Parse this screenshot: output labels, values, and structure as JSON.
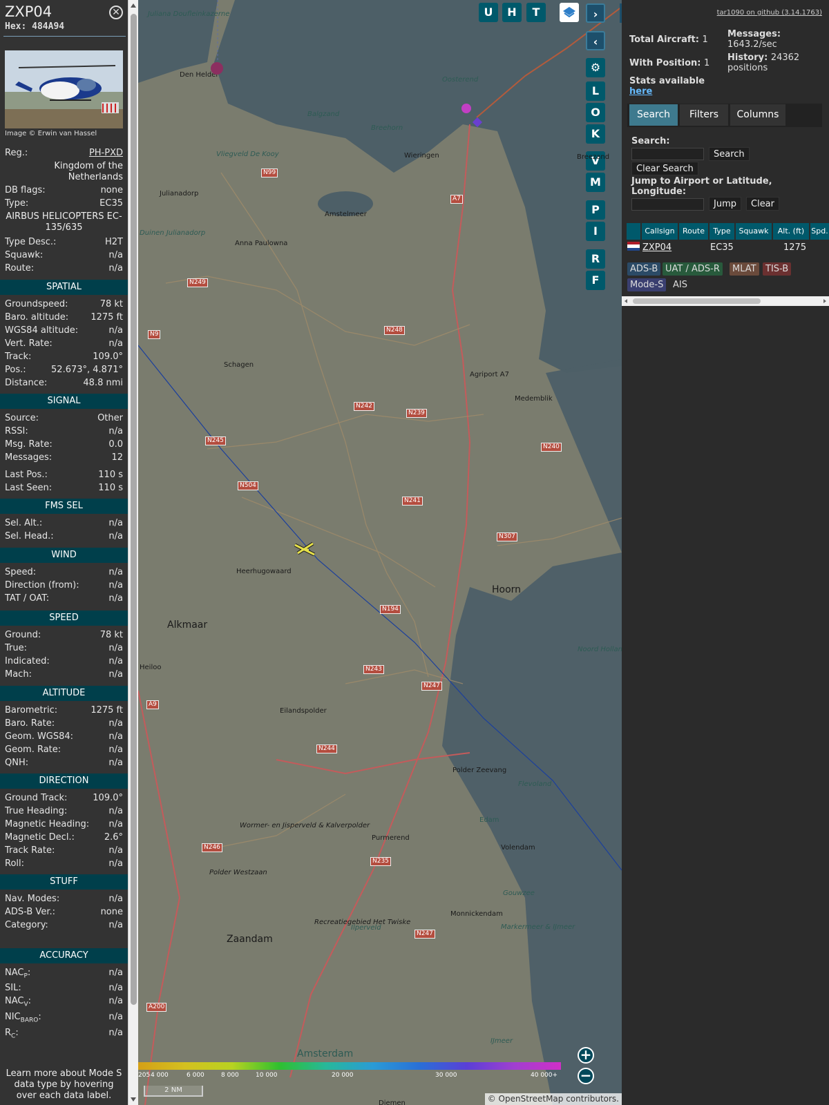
{
  "aircraft": {
    "title": "ZXP04",
    "hex_label": "Hex:",
    "hex": "484A94",
    "photo_credit": "Image © Erwin van Hassel",
    "reg_label": "Reg.:",
    "reg": "PH-PXD",
    "country": "Kingdom of the Netherlands",
    "dbflags_label": "DB flags:",
    "dbflags": "none",
    "type_label": "Type:",
    "type": "EC35",
    "type_full": "AIRBUS HELICOPTERS EC-135/635",
    "typedesc_label": "Type Desc.:",
    "typedesc": "H2T",
    "squawk_label": "Squawk:",
    "squawk": "n/a",
    "route_label": "Route:",
    "route": "n/a"
  },
  "sections": {
    "spatial": "SPATIAL",
    "signal": "SIGNAL",
    "fms": "FMS SEL",
    "wind": "WIND",
    "speed": "SPEED",
    "altitude": "ALTITUDE",
    "direction": "DIRECTION",
    "stuff": "STUFF",
    "accuracy": "ACCURACY"
  },
  "spatial": [
    [
      "Groundspeed:",
      "78 kt"
    ],
    [
      "Baro. altitude:",
      "1275 ft"
    ],
    [
      "WGS84 altitude:",
      "n/a"
    ],
    [
      "Vert. Rate:",
      "n/a"
    ],
    [
      "Track:",
      "109.0°"
    ],
    [
      "Pos.:",
      "52.673°, 4.871°"
    ],
    [
      "Distance:",
      "48.8 nmi"
    ]
  ],
  "signal": [
    [
      "Source:",
      "Other"
    ],
    [
      "RSSI:",
      "n/a"
    ],
    [
      "Msg. Rate:",
      "0.0"
    ],
    [
      "Messages:",
      "12"
    ],
    [
      "Last Pos.:",
      "110 s"
    ],
    [
      "Last Seen:",
      "110 s"
    ]
  ],
  "fms": [
    [
      "Sel. Alt.:",
      "n/a"
    ],
    [
      "Sel. Head.:",
      "n/a"
    ]
  ],
  "wind": [
    [
      "Speed:",
      "n/a"
    ],
    [
      "Direction (from):",
      "n/a"
    ],
    [
      "TAT / OAT:",
      "n/a"
    ]
  ],
  "speed": [
    [
      "Ground:",
      "78 kt"
    ],
    [
      "True:",
      "n/a"
    ],
    [
      "Indicated:",
      "n/a"
    ],
    [
      "Mach:",
      "n/a"
    ]
  ],
  "altitude": [
    [
      "Barometric:",
      "1275 ft"
    ],
    [
      "Baro. Rate:",
      "n/a"
    ],
    [
      "Geom. WGS84:",
      "n/a"
    ],
    [
      "Geom. Rate:",
      "n/a"
    ],
    [
      "QNH:",
      "n/a"
    ]
  ],
  "direction": [
    [
      "Ground Track:",
      "109.0°"
    ],
    [
      "True Heading:",
      "n/a"
    ],
    [
      "Magnetic Heading:",
      "n/a"
    ],
    [
      "Magnetic Decl.:",
      "2.6°"
    ],
    [
      "Track Rate:",
      "n/a"
    ],
    [
      "Roll:",
      "n/a"
    ]
  ],
  "stuff": [
    [
      "Nav. Modes:",
      "n/a"
    ],
    [
      "ADS-B Ver.:",
      "none"
    ],
    [
      "Category:",
      "n/a"
    ]
  ],
  "accuracy": {
    "nacp": "NAC",
    "nacp_sub": "P",
    "nacp_val": "n/a",
    "sil": "SIL:",
    "sil_val": "n/a",
    "nacv": "NAC",
    "nacv_sub": "V",
    "nacv_val": "n/a",
    "nic": "NIC",
    "nic_sub": "BARO",
    "nic_val": "n/a",
    "rc": "R",
    "rc_sub": "C",
    "rc_val": "n/a",
    "colon": ":"
  },
  "footer_note": "Learn more about Mode S data type by hovering over each data label.",
  "map": {
    "buttons_top": [
      "U",
      "H",
      "T"
    ],
    "buttons_side": [
      "L",
      "O",
      "K",
      "V",
      "M",
      "P",
      "I",
      "R",
      "F"
    ],
    "places": [
      "Den Helder",
      "Balgzand",
      "Breehorn",
      "Wieringen",
      "Julianadorp",
      "Amstelmeer",
      "Anna Paulowna",
      "Schagen",
      "Agriport A7",
      "Medemblik",
      "Heerhugowaard",
      "Hoorn",
      "Alkmaar",
      "Heiloo",
      "Eilandspolder",
      "Polder Zeevang",
      "Edam",
      "Volendam",
      "Purmerend",
      "Monnickendam",
      "Zaandam",
      "Amsterdam",
      "Diemen",
      "Wormer- en Jisperveld & Kalverpolder",
      "Polder Westzaan",
      "Recreatiegebied Het Twiske",
      "Ilperveld",
      "Markermeer & IJmeer",
      "IJmeer",
      "Gouwzee",
      "Noord Holland",
      "Flevoland",
      "Breezand",
      "Juliana Doufleinkazerne",
      "Duinen Julianadorp",
      "Vliegveld De Kooy",
      "Oosterend"
    ],
    "roads": [
      "N99",
      "A7",
      "N249",
      "N9",
      "N248",
      "N242",
      "N239",
      "N245",
      "N240",
      "N504",
      "N241",
      "N307",
      "N194",
      "N243",
      "N247",
      "A9",
      "N244",
      "N246",
      "N235",
      "N247",
      "A200"
    ],
    "scale": "2 NM",
    "attribution": "© OpenStreetMap contributors.",
    "alt_ticks": [
      "205",
      "4 000",
      "6 000",
      "8 000",
      "10 000",
      "20 000",
      "30 000",
      "40 000+"
    ]
  },
  "right": {
    "github": "tar1090 on github (3.14.1763)",
    "total_label": "Total Aircraft:",
    "total": "1",
    "pos_label": "With Position:",
    "pos": "1",
    "msgs_label": "Messages:",
    "msgs": "1643.2/sec",
    "history_label": "History:",
    "history": "24362 positions",
    "stats": "Stats available",
    "here": "here",
    "tabs": [
      "Search",
      "Filters",
      "Columns"
    ],
    "search_label": "Search:",
    "search_btn": "Search",
    "clear_search": "Clear Search",
    "jump_label": "Jump to Airport or Latitude, Longitude:",
    "jump_btn": "Jump",
    "clear_btn": "Clear",
    "columns": [
      "Callsign",
      "Route",
      "Type",
      "Squawk",
      "Alt. (ft)",
      "Spd."
    ],
    "row": {
      "callsign": "ZXP04",
      "route": "",
      "type": "EC35",
      "squawk": "",
      "alt": "1275",
      "spd": ""
    },
    "legend": [
      "ADS-B",
      "UAT / ADS-R",
      "MLAT",
      "TIS-B",
      "Mode-S",
      "AIS"
    ],
    "colors": {
      "adsb": "#2b4a66",
      "uat": "#285a3c",
      "mlat": "#6a4a3b",
      "tisb": "#6b3030",
      "modes": "#3a3f70"
    }
  }
}
